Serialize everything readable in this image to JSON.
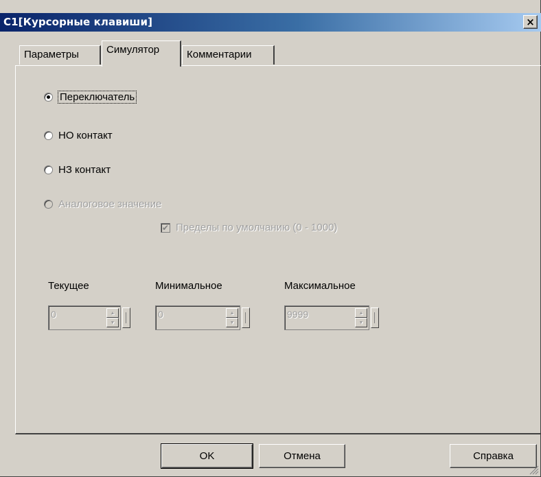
{
  "window": {
    "title": "C1[Курсорные клавиши]",
    "close_label": "×"
  },
  "tabs": [
    {
      "label": "Параметры",
      "active": false
    },
    {
      "label": "Симулятор",
      "active": true
    },
    {
      "label": "Комментарии",
      "active": false
    }
  ],
  "simulator": {
    "radios": [
      {
        "label": "Переключатель",
        "checked": true,
        "enabled": true
      },
      {
        "label": "НО контакт",
        "checked": false,
        "enabled": true
      },
      {
        "label": "НЗ контакт",
        "checked": false,
        "enabled": true
      },
      {
        "label": "Аналоговое значение",
        "checked": false,
        "enabled": false
      }
    ],
    "default_limits": {
      "label": "Пределы по умолчанию (0 - 1000)",
      "checked": true,
      "enabled": false
    },
    "spinners": [
      {
        "label": "Текущее",
        "value": "0"
      },
      {
        "label": "Минимальное",
        "value": "0"
      },
      {
        "label": "Максимальное",
        "value": "9999"
      }
    ]
  },
  "buttons": {
    "ok": "OK",
    "cancel": "Отмена",
    "help": "Справка"
  },
  "icons": {
    "close": "close-icon",
    "up": "up-arrow-icon",
    "down": "down-arrow-icon",
    "grip": "resize-grip-icon"
  },
  "colors": {
    "face": "#d4d0c8",
    "title_start": "#0a246a",
    "title_end": "#a6caf0",
    "disabled_text": "#a0a0a0"
  }
}
